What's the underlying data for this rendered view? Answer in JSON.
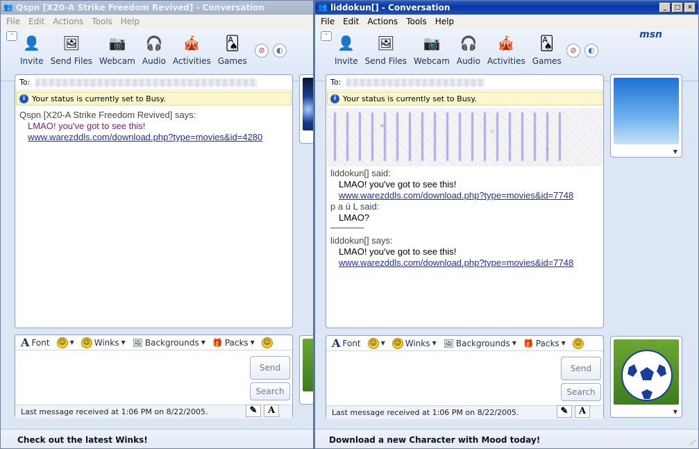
{
  "window1": {
    "title": "Qspn [X20-A Strike Freedom Revived] - Conversation",
    "menu": [
      "File",
      "Edit",
      "Actions",
      "Tools",
      "Help"
    ],
    "toolbar": [
      "Invite",
      "Send Files",
      "Webcam",
      "Audio",
      "Activities",
      "Games"
    ],
    "to_label": "To:",
    "status": "Your status is currently set to Busy.",
    "chat": {
      "sender": "Qspn [X20-A Strike Freedom Revived] says:",
      "message": "LMAO! you've got to see this!",
      "link": "www.warezddls.com/download.php?type=movies&id=4280"
    },
    "format": {
      "font": "Font",
      "winks": "Winks",
      "backgrounds": "Backgrounds",
      "packs": "Packs"
    },
    "send": "Send",
    "search": "Search",
    "last_message": "Last message received at 1:06 PM on 8/22/2005.",
    "footer": "Check out the latest Winks!"
  },
  "window2": {
    "title": "liddokun[] - Conversation",
    "menu": [
      "File",
      "Edit",
      "Actions",
      "Tools",
      "Help"
    ],
    "toolbar": [
      "Invite",
      "Send Files",
      "Webcam",
      "Audio",
      "Activities",
      "Games"
    ],
    "brand": "msn",
    "to_label": "To:",
    "status": "Your status is currently set to Busy.",
    "chat": [
      {
        "sender": "liddokun[] said:",
        "message": "LMAO! you've got to see this!",
        "link": "www.warezddls.com/download.php?type=movies&id=7748"
      },
      {
        "sender": "p a ú L said:",
        "message": "LMAO?"
      },
      {
        "sender": "liddokun[] says:",
        "message": "LMAO! you've got to see this!",
        "link": "www.warezddls.com/download.php?type=movies&id=7748"
      }
    ],
    "format": {
      "font": "Font",
      "winks": "Winks",
      "backgrounds": "Backgrounds",
      "packs": "Packs"
    },
    "send": "Send",
    "search": "Search",
    "last_message": "Last message received at 1:06 PM on 8/22/2005.",
    "footer": "Download a new Character with Mood today!"
  },
  "colors": {
    "titlebar_active": "#0a36a4",
    "link": "#1a2bc2",
    "status_bg": "#fbf6cc",
    "window_bg": "#dce6f4"
  },
  "icons": [
    "invite-icon",
    "send-files-icon",
    "webcam-icon",
    "audio-icon",
    "activities-icon",
    "games-icon",
    "block-icon",
    "background-icon",
    "info-icon"
  ]
}
